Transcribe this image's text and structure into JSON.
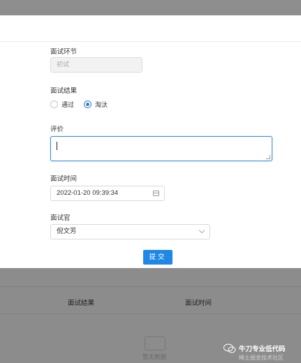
{
  "form": {
    "stage_label": "面试环节",
    "stage_value": "初试",
    "result_label": "面试结果",
    "result_options": [
      "通过",
      "淘汰"
    ],
    "result_selected": "淘汰",
    "comment_label": "评价",
    "comment_value": "",
    "time_label": "面试时间",
    "time_value": "2022-01-20 09:39:34",
    "interviewer_label": "面试官",
    "interviewer_value": "倪文芳",
    "submit_label": "提交"
  },
  "background_table": {
    "columns": [
      "面试结果",
      "面试时间"
    ],
    "empty_text": "暂无数据"
  },
  "watermark": {
    "title": "牛刀专业低代码",
    "subtitle": "稀土掘金技术社区"
  }
}
